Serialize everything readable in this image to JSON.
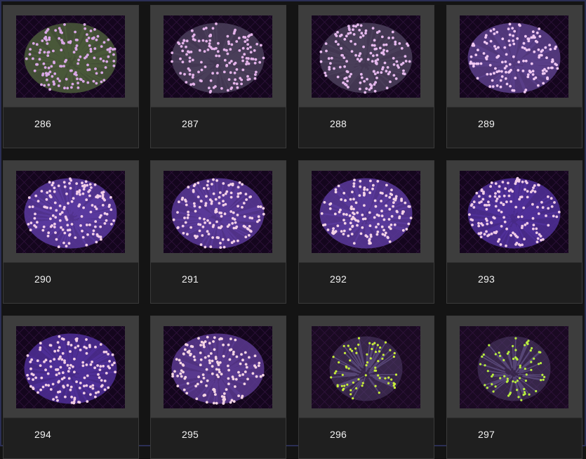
{
  "gallery": {
    "items": [
      {
        "label": "286",
        "palette": "violet",
        "tip": "#d9a8e6",
        "stem": "#4a5a3a"
      },
      {
        "label": "287",
        "palette": "violet",
        "tip": "#e4b3ea",
        "stem": "#4a3f5a"
      },
      {
        "label": "288",
        "palette": "violet",
        "tip": "#e6b9ee",
        "stem": "#4a3f5a"
      },
      {
        "label": "289",
        "palette": "violet",
        "tip": "#f0c8f2",
        "stem": "#5a3f8a"
      },
      {
        "label": "290",
        "palette": "violet",
        "tip": "#f1cde8",
        "stem": "#5b3aa0"
      },
      {
        "label": "291",
        "palette": "violet",
        "tip": "#f2cfe6",
        "stem": "#5b3a9a"
      },
      {
        "label": "292",
        "palette": "violet",
        "tip": "#f3d2e6",
        "stem": "#5a3a9c"
      },
      {
        "label": "293",
        "palette": "violet",
        "tip": "#efcbe6",
        "stem": "#50309a"
      },
      {
        "label": "294",
        "palette": "violet",
        "tip": "#f1cde4",
        "stem": "#4f2f98"
      },
      {
        "label": "295",
        "palette": "violet",
        "tip": "#f4d4e3",
        "stem": "#5a3a90"
      },
      {
        "label": "296",
        "palette": "green",
        "tip": "#c9f03a",
        "stem": "#5a4a7a"
      },
      {
        "label": "297",
        "palette": "green",
        "tip": "#b9ef3f",
        "stem": "#5a4a7a"
      }
    ]
  }
}
